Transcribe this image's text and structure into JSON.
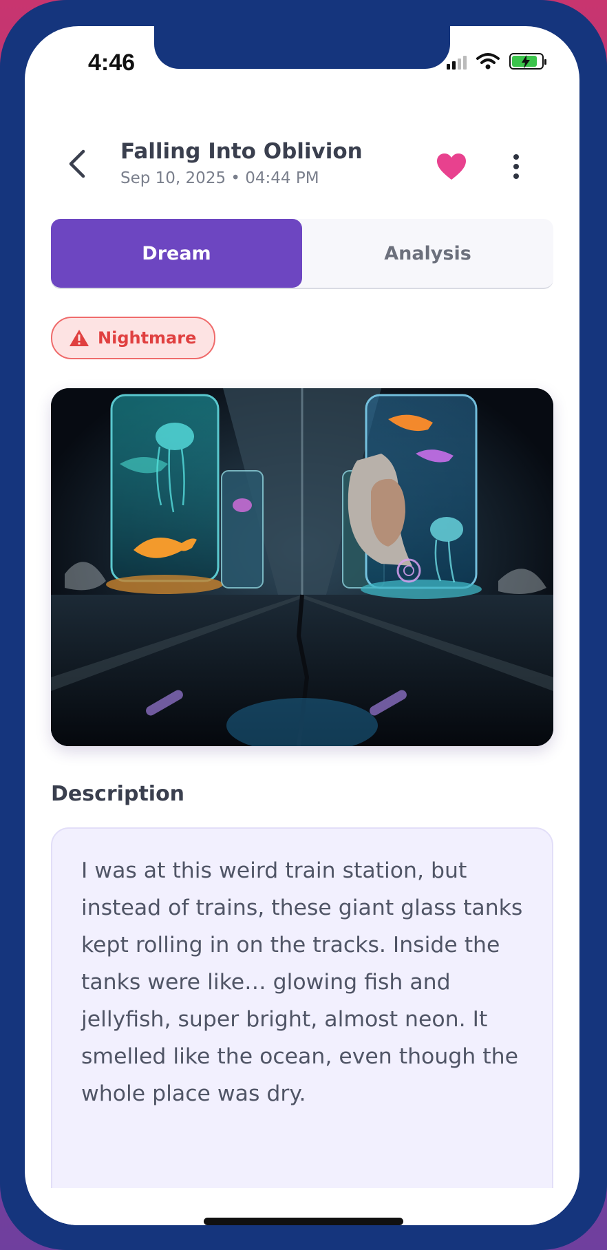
{
  "status_bar": {
    "time": "4:46"
  },
  "header": {
    "title": "Falling Into Oblivion",
    "datetime": "Sep 10, 2025 • 04:44 PM",
    "favorite": true
  },
  "tabs": [
    {
      "label": "Dream",
      "active": true
    },
    {
      "label": "Analysis",
      "active": false
    }
  ],
  "badge": {
    "label": "Nightmare",
    "icon": "warning-icon",
    "color": "#e04040"
  },
  "dream_image": {
    "icon": "dream-artwork"
  },
  "description": {
    "heading": "Description",
    "text": "I was at this weird train station, but instead of trains, these giant glass tanks kept rolling in on the tracks. Inside the tanks were like… glowing fish and jellyfish, super bright, almost neon. It smelled like the ocean, even though the whole place was dry."
  },
  "colors": {
    "accent": "#6d46c1",
    "heart": "#e8418e",
    "frame": "#15357d"
  }
}
